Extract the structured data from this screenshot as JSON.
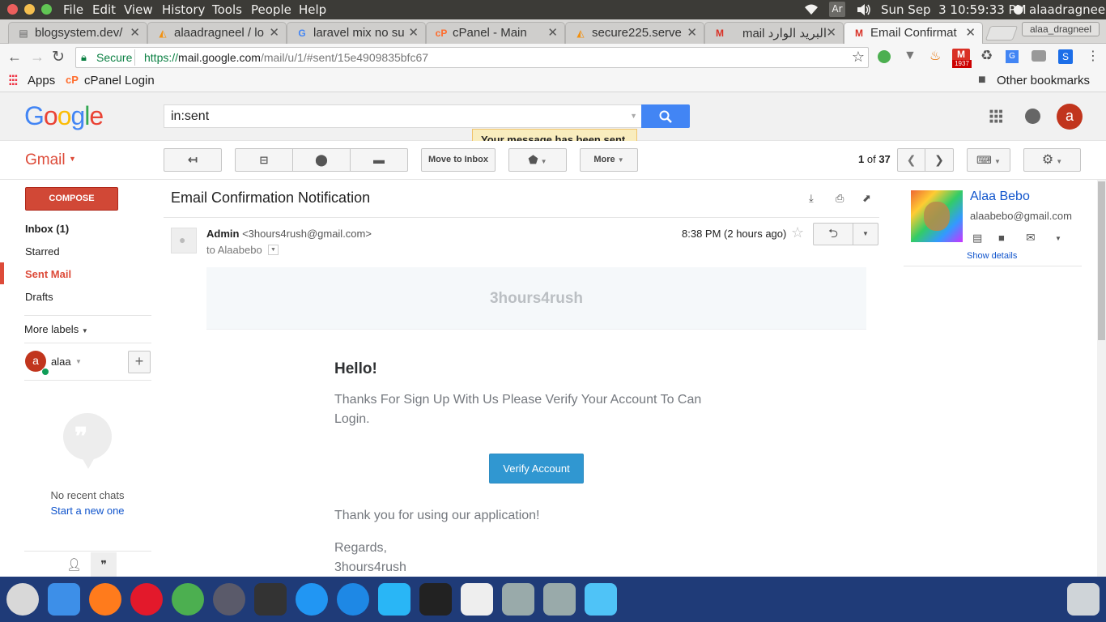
{
  "menubar": {
    "menus": [
      "File",
      "Edit",
      "View",
      "History",
      "Tools",
      "People",
      "Help"
    ],
    "status_keyboard": "Ar",
    "clock": "Sun Sep  3 10:59:33 PM",
    "user": "alaadragneel"
  },
  "tabs": [
    {
      "title": "blogsystem.dev/",
      "icon": "document-icon"
    },
    {
      "title": "alaadragneel / lo",
      "icon": "phpmyadmin-icon"
    },
    {
      "title": "laravel mix no su",
      "icon": "google-icon"
    },
    {
      "title": "cPanel - Main",
      "icon": "cpanel-icon"
    },
    {
      "title": "secure225.serve",
      "icon": "phpmyadmin-icon"
    },
    {
      "title": "البريد الوارد mail",
      "icon": "gmail-icon"
    },
    {
      "title": "Email Confirmat",
      "icon": "gmail-icon"
    }
  ],
  "profile_badge": "alaa_dragneel",
  "address": {
    "secure_label": "Secure",
    "url_prefix": "https://",
    "url_host": "mail.google.com",
    "url_path": "/mail/u/1/#sent/15e4909835bfc67"
  },
  "extension_badge": "1937",
  "bookmarks": {
    "apps": "Apps",
    "cpanel": "cPanel Login",
    "other": "Other bookmarks"
  },
  "gmail": {
    "logo": "Google",
    "search_value": "in:sent",
    "toast": "Your message has been sent.",
    "brand": "Gmail",
    "avatar_letter": "a",
    "toolbar": {
      "move_to_inbox": "Move to Inbox",
      "more": "More"
    },
    "pager": {
      "current": "1",
      "of": "of",
      "total": "37"
    },
    "compose": "COMPOSE",
    "nav": {
      "inbox": "Inbox (1)",
      "starred": "Starred",
      "sent": "Sent Mail",
      "drafts": "Drafts",
      "more_labels": "More labels"
    },
    "hangouts": {
      "user": "alaa",
      "user_letter": "a",
      "no_chats": "No recent chats",
      "start_new": "Start a new one"
    },
    "subject": "Email Confirmation Notification",
    "message": {
      "sender_name": "Admin",
      "sender_email": "<3hours4rush@gmail.com>",
      "to": "to Alaabebo",
      "time": "8:38 PM (2 hours ago)"
    },
    "email_body": {
      "brand": "3hours4rush",
      "greeting": "Hello!",
      "intro": "Thanks For Sign Up With Us Please Verify Your Account To Can Login.",
      "button": "Verify Account",
      "outro": "Thank you for using our application!",
      "regards": "Regards,",
      "signature": "3hours4rush"
    },
    "contact": {
      "name": "Alaa Bebo",
      "email": "alaabebo@gmail.com",
      "show_details": "Show details"
    }
  },
  "colors": {
    "gmail_red": "#dd4b39",
    "blue": "#4285f4",
    "verify_button": "#3097d1",
    "dock": "#1f3b78"
  }
}
